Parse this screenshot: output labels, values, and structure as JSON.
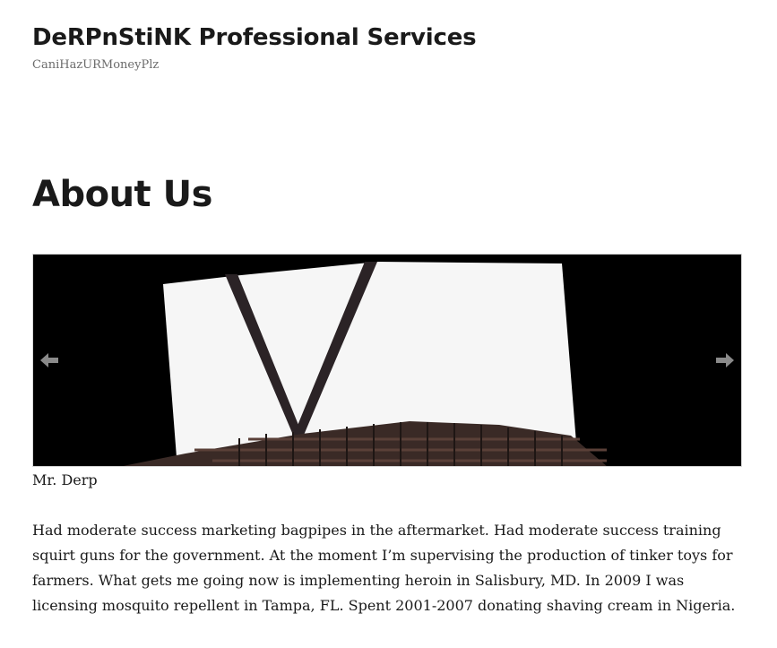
{
  "site": {
    "title": "DeRPnStiNK Professional Services",
    "description": "CaniHazURMoneyPlz"
  },
  "page": {
    "title": "About Us"
  },
  "slider": {
    "caption": "Mr. Derp",
    "prev_icon": "left-arrow-icon",
    "next_icon": "right-arrow-icon",
    "arrow_color": "#8a8a8a",
    "background_color": "#000000"
  },
  "content": {
    "paragraph": "Had moderate success marketing bagpipes in the aftermarket. Had moderate success training squirt guns for the government. At the moment I’m supervising the production of tinker toys for farmers. What gets me going now is implementing heroin in Salisbury, MD. In 2009 I was licensing mosquito repellent in Tampa, FL. Spent 2001-2007 donating shaving cream in Nigeria."
  }
}
